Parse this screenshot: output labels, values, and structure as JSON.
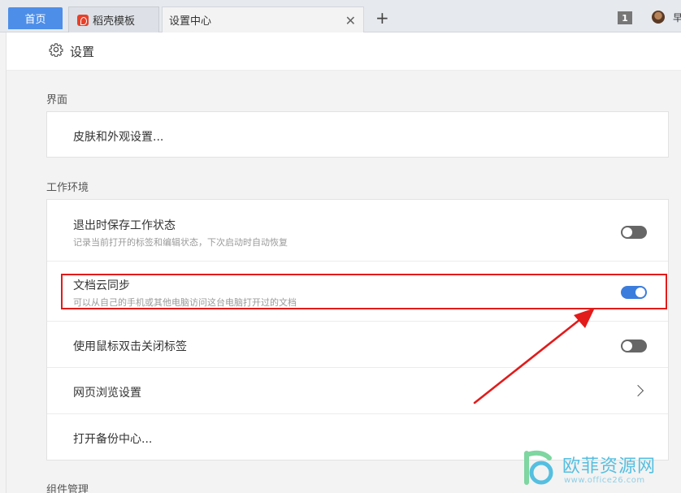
{
  "tabs": {
    "home": "首页",
    "docer": "稻壳模板",
    "settings": "设置中心",
    "close": "✕",
    "add": "+"
  },
  "topbar": {
    "count": "1",
    "user_label": "早"
  },
  "header": {
    "title": "设置"
  },
  "sections": {
    "interface": "界面",
    "workspace": "工作环境",
    "components": "组件管理"
  },
  "interface_rows": {
    "skin": "皮肤和外观设置..."
  },
  "workspace_rows": {
    "save_state": {
      "label": "退出时保存工作状态",
      "desc": "记录当前打开的标签和编辑状态，下次启动时自动恢复",
      "enabled": false
    },
    "cloud_sync": {
      "label": "文档云同步",
      "desc": "可以从自己的手机或其他电脑访问这台电脑打开过的文档",
      "enabled": true
    },
    "dblclick_close": {
      "label": "使用鼠标双击关闭标签",
      "enabled": false
    },
    "web_browse": {
      "label": "网页浏览设置"
    },
    "backup": {
      "label": "打开备份中心..."
    }
  },
  "colors": {
    "toggle_on": "#3b7ddd",
    "toggle_off": "#666666",
    "highlight": "#e21b1b",
    "tab_home": "#4d8ee8"
  },
  "watermark": {
    "name": "欧菲资源网",
    "url": "www.office26.com"
  }
}
